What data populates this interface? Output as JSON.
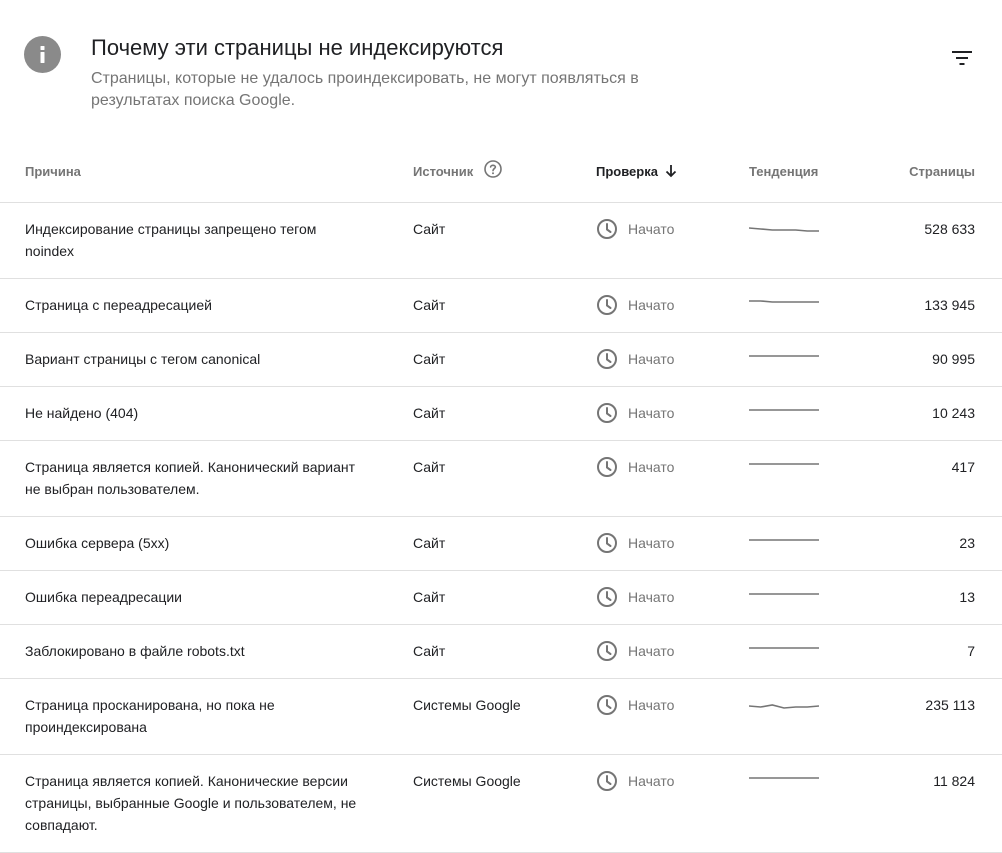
{
  "header": {
    "title": "Почему эти страницы не индексируются",
    "subtitle": "Страницы, которые не удалось проиндексировать, не могут появляться в результатах поиска Google.",
    "info_icon": "info-icon",
    "filter_icon": "filter-list-icon"
  },
  "table": {
    "columns": {
      "reason": "Причина",
      "source": "Источник",
      "validation": "Проверка",
      "trend": "Тенденция",
      "pages": "Страницы"
    },
    "sorted_column": "validation",
    "sort_direction": "descending",
    "rows": [
      {
        "reason": "Индексирование страницы запрещено тегом noindex",
        "source": "Сайт",
        "status": "Начато",
        "trend": [
          8,
          9,
          10,
          10,
          10,
          11,
          11
        ],
        "pages": "528 633"
      },
      {
        "reason": "Страница с переадресацией",
        "source": "Сайт",
        "status": "Начато",
        "trend": [
          5,
          5,
          6,
          6,
          6,
          6,
          6
        ],
        "pages": "133 945"
      },
      {
        "reason": "Вариант страницы с тегом canonical",
        "source": "Сайт",
        "status": "Начато",
        "trend": [
          6,
          6,
          6,
          6,
          6,
          6,
          6
        ],
        "pages": "90 995"
      },
      {
        "reason": "Не найдено (404)",
        "source": "Сайт",
        "status": "Начато",
        "trend": [
          6,
          6,
          6,
          6,
          6,
          6,
          6
        ],
        "pages": "10 243"
      },
      {
        "reason": "Страница является копией. Канонический вариант не выбран пользователем.",
        "source": "Сайт",
        "status": "Начато",
        "trend": [
          6,
          6,
          6,
          6,
          6,
          6,
          6
        ],
        "pages": "417"
      },
      {
        "reason": "Ошибка сервера (5xx)",
        "source": "Сайт",
        "status": "Начато",
        "trend": [
          6,
          6,
          6,
          6,
          6,
          6,
          6
        ],
        "pages": "23"
      },
      {
        "reason": "Ошибка переадресации",
        "source": "Сайт",
        "status": "Начато",
        "trend": [
          6,
          6,
          6,
          6,
          6,
          6,
          6
        ],
        "pages": "13"
      },
      {
        "reason": "Заблокировано в файле robots.txt",
        "source": "Сайт",
        "status": "Начато",
        "trend": [
          6,
          6,
          6,
          6,
          6,
          6,
          6
        ],
        "pages": "7"
      },
      {
        "reason": "Страница просканирована, но пока не проиндексирована",
        "source": "Системы Google",
        "status": "Начато",
        "trend": [
          10,
          11,
          9,
          12,
          11,
          11,
          10
        ],
        "pages": "235 113"
      },
      {
        "reason": "Страница является копией. Канонические версии страницы, выбранные Google и пользователем, не совпадают.",
        "source": "Системы Google",
        "status": "Начато",
        "trend": [
          6,
          6,
          6,
          6,
          6,
          6,
          6
        ],
        "pages": "11 824"
      }
    ]
  },
  "colors": {
    "icon_grey": "#8a8a8a",
    "text_primary": "#202124",
    "text_secondary": "#757575",
    "divider": "#e0e0e0",
    "sparkline": "#757575"
  }
}
